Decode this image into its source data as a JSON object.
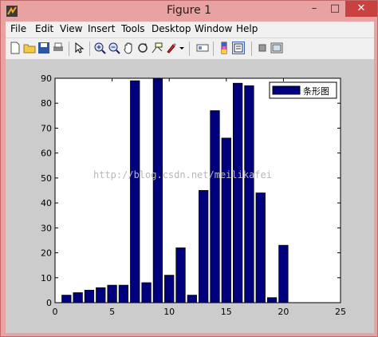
{
  "window": {
    "title": "Figure 1",
    "minimize": "–",
    "maximize": "□",
    "close": "✕"
  },
  "menu": [
    "File",
    "Edit",
    "View",
    "Insert",
    "Tools",
    "Desktop",
    "Window",
    "Help"
  ],
  "toolbar": [
    "new-figure-icon",
    "open-file-icon",
    "save-icon",
    "print-icon",
    "edit-plot-arrow-icon",
    "zoom-in-icon",
    "zoom-out-icon",
    "pan-hand-icon",
    "rotate-3d-icon",
    "data-cursor-icon",
    "brush-icon",
    "brush-dropdown-icon",
    "link-plot-icon",
    "insert-colorbar-icon",
    "insert-legend-icon",
    "hide-plot-tools-icon",
    "show-plot-tools-icon"
  ],
  "watermark": "http://blog.csdn.net/meilikafei",
  "colors": {
    "bar": "#00007f",
    "title_bg": "#e8a2a2",
    "close": "#c9423f",
    "plot_bg": "#cccccc"
  },
  "chart_data": {
    "type": "bar",
    "x": [
      1,
      2,
      3,
      4,
      5,
      6,
      7,
      8,
      9,
      10,
      11,
      12,
      13,
      14,
      15,
      16,
      17,
      18,
      19,
      20
    ],
    "series": [
      {
        "name": "条形图",
        "values": [
          3,
          4,
          5,
          6,
          7,
          7,
          89,
          8,
          90,
          11,
          22,
          3,
          45,
          77,
          66,
          88,
          87,
          44,
          2,
          23
        ]
      }
    ],
    "xlim": [
      0,
      25
    ],
    "ylim": [
      0,
      90
    ],
    "xticks": [
      "0",
      "5",
      "10",
      "15",
      "20",
      "25"
    ],
    "yticks": [
      "0",
      "10",
      "20",
      "30",
      "40",
      "50",
      "60",
      "70",
      "80",
      "90"
    ],
    "grid": false,
    "legend_position": "top-right",
    "title": "",
    "xlabel": "",
    "ylabel": ""
  }
}
